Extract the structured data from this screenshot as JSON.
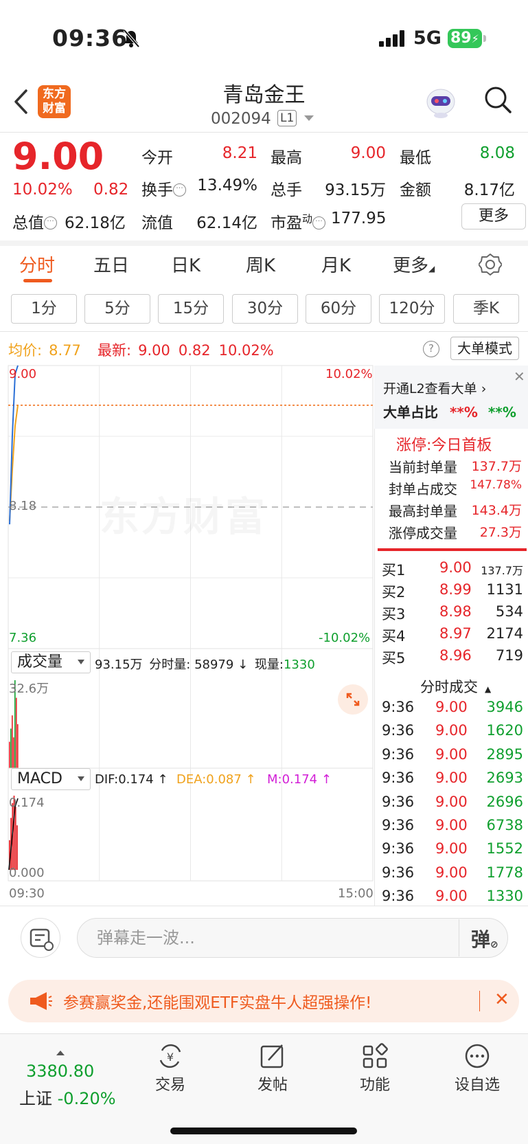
{
  "status": {
    "time": "09:36",
    "network": "5G",
    "battery": "89"
  },
  "header": {
    "logo_line1": "东方",
    "logo_line2": "财富",
    "title": "青岛金王",
    "code": "002094",
    "level": "L1"
  },
  "quote": {
    "price": "9.00",
    "change_pct": "10.02%",
    "change": "0.82",
    "open_label": "今开",
    "open": "8.21",
    "high_label": "最高",
    "high": "9.00",
    "low_label": "最低",
    "low": "8.08",
    "turnover_label": "换手",
    "turnover": "13.49%",
    "volume_label": "总手",
    "volume": "93.15万",
    "amount_label": "金额",
    "amount": "8.17亿",
    "mktcap_label": "总值",
    "mktcap": "62.18亿",
    "float_label": "流值",
    "float": "62.14亿",
    "pe_label": "市盈",
    "pe_sup": "动",
    "pe": "177.95",
    "more": "更多"
  },
  "tabs": [
    "分时",
    "五日",
    "日K",
    "周K",
    "月K",
    "更多"
  ],
  "subtabs": [
    "1分",
    "5分",
    "15分",
    "30分",
    "60分",
    "120分",
    "季K"
  ],
  "infoline": {
    "avg_label": "均价:",
    "avg": "8.77",
    "last_label": "最新:",
    "last": "9.00",
    "chg": "0.82",
    "chg_pct": "10.02%",
    "help": "?",
    "bigorder_mode": "大单模式"
  },
  "chart_data": {
    "type": "line",
    "y_max": "9.00",
    "y_min": "7.36",
    "y_ref": "8.18",
    "pct_max": "10.02%",
    "pct_min": "-10.02%",
    "x_start": "09:30",
    "x_end": "15:00",
    "price_series": [
      8.08,
      8.6,
      8.95,
      9.0
    ],
    "avg_series": [
      8.1,
      8.4,
      8.65,
      8.77
    ],
    "volume": {
      "selector": "成交量",
      "total": "93.15万",
      "period_label": "分时量:",
      "period": "58979",
      "period_dir": "↓",
      "current_label": "现量:",
      "current": "1330",
      "max_label": "32.6万"
    },
    "macd": {
      "selector": "MACD",
      "dif": "DIF:0.174 ↑",
      "dea": "DEA:0.087 ↑",
      "m": "M:0.174 ↑",
      "max_label": "0.174",
      "min_label": "0.000"
    }
  },
  "panel": {
    "l2_link": "开通L2查看大单",
    "ratio_label": "大单占比",
    "ratio_buy": "**%",
    "ratio_sell": "**%",
    "limit_title": "涨停:今日首板",
    "limit_rows": [
      {
        "label": "当前封单量",
        "value": "137.7万"
      },
      {
        "label": "封单占成交",
        "value": "147.78%"
      },
      {
        "label": "最高封单量",
        "value": "143.4万"
      },
      {
        "label": "涨停成交量",
        "value": "27.3万"
      }
    ],
    "book": [
      {
        "label": "买1",
        "price": "9.00",
        "qty": "137.7万"
      },
      {
        "label": "买2",
        "price": "8.99",
        "qty": "1131"
      },
      {
        "label": "买3",
        "price": "8.98",
        "qty": "534"
      },
      {
        "label": "买4",
        "price": "8.97",
        "qty": "2174"
      },
      {
        "label": "买5",
        "price": "8.96",
        "qty": "719"
      }
    ],
    "trades_title": "分时成交",
    "trades": [
      {
        "t": "9:36",
        "p": "9.00",
        "q": "3946"
      },
      {
        "t": "9:36",
        "p": "9.00",
        "q": "1620"
      },
      {
        "t": "9:36",
        "p": "9.00",
        "q": "2895"
      },
      {
        "t": "9:36",
        "p": "9.00",
        "q": "2693"
      },
      {
        "t": "9:36",
        "p": "9.00",
        "q": "2696"
      },
      {
        "t": "9:36",
        "p": "9.00",
        "q": "6738"
      },
      {
        "t": "9:36",
        "p": "9.00",
        "q": "1552"
      },
      {
        "t": "9:36",
        "p": "9.00",
        "q": "1778"
      },
      {
        "t": "9:36",
        "p": "9.00",
        "q": "1330"
      }
    ]
  },
  "danmu": {
    "placeholder": "弹幕走一波...",
    "button": "弹"
  },
  "banner": {
    "text": "参赛赢奖金,还能围观ETF实盘牛人超强操作!"
  },
  "nav": {
    "index_value": "3380.80",
    "index_name": "上证",
    "index_change": "-0.20%",
    "items": [
      "交易",
      "发帖",
      "功能",
      "设自选"
    ]
  },
  "watermark": "东方财富"
}
